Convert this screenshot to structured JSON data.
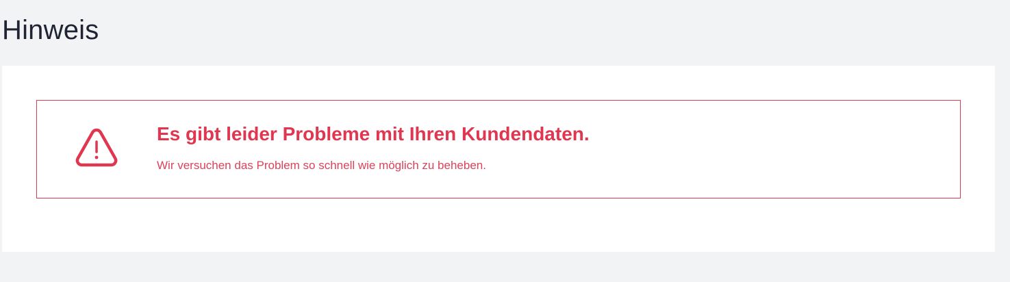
{
  "page": {
    "title": "Hinweis"
  },
  "alert": {
    "icon": "warning-triangle-icon",
    "heading": "Es gibt leider Probleme mit Ihren Kundendaten.",
    "message": "Wir versuchen das Problem so schnell wie möglich zu beheben.",
    "accent_color": "#e0364f"
  }
}
